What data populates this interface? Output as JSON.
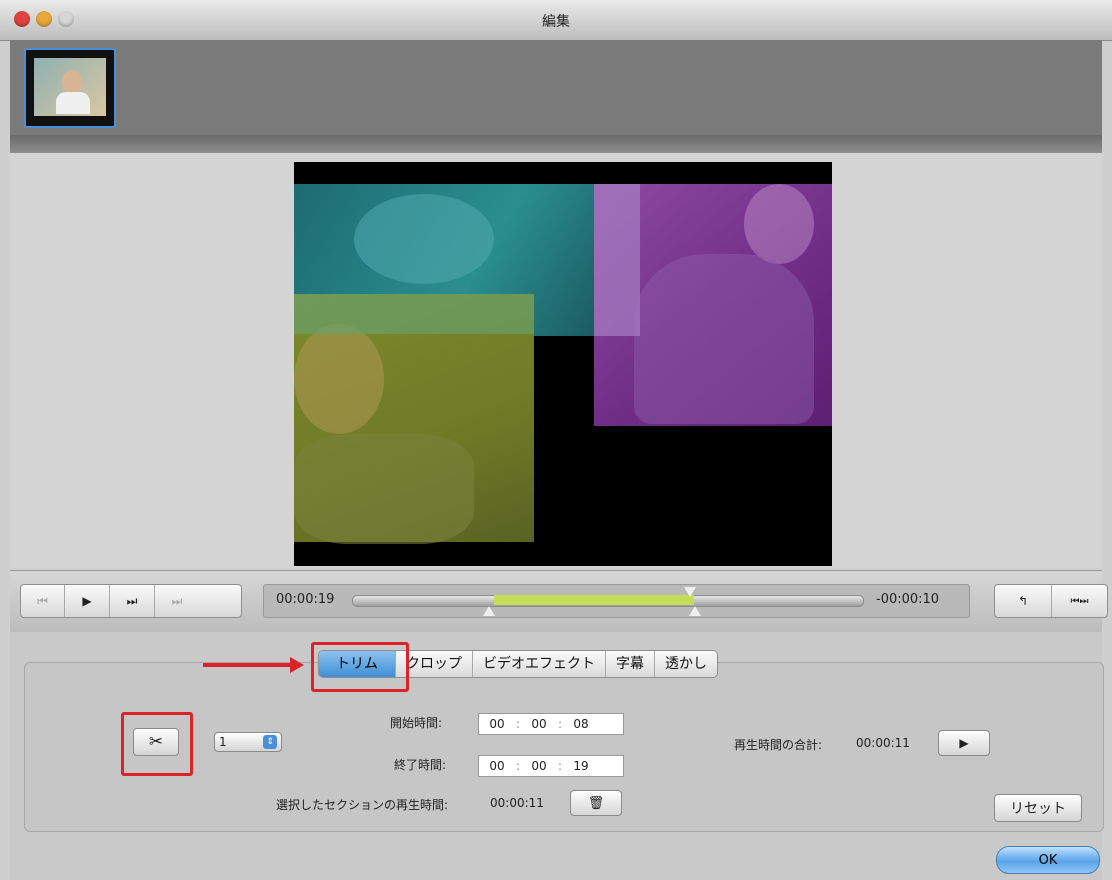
{
  "window": {
    "title": "編集"
  },
  "timeline": {
    "current_time": "00:00:19",
    "remaining_time": "-00:00:10"
  },
  "playback": {
    "prev": "⏮",
    "play": "▶",
    "fast_forward": "⏭",
    "next": "⏭"
  },
  "right_controls": {
    "rotate": "↰",
    "split": "⏮⏭"
  },
  "tabs": [
    {
      "label": "トリム"
    },
    {
      "label": "クロップ"
    },
    {
      "label": "ビデオエフェクト"
    },
    {
      "label": "字幕"
    },
    {
      "label": "透かし"
    }
  ],
  "trim": {
    "segment_select": "1",
    "start_time_label": "開始時間:",
    "start_time": {
      "h": "00",
      "m": "00",
      "s": "08"
    },
    "end_time_label": "終了時間:",
    "end_time": {
      "h": "00",
      "m": "00",
      "s": "19"
    },
    "selected_section_label": "選択したセクションの再生時間:",
    "selected_section_duration": "00:00:11",
    "total_playback_label": "再生時間の合計:",
    "total_playback_duration": "00:00:11",
    "reset_label": "リセット"
  },
  "ok_label": "OK",
  "colors": {
    "selection": "#c3dc5a",
    "highlight_red": "#d9252a",
    "tab_active": "#3f8fd6"
  }
}
